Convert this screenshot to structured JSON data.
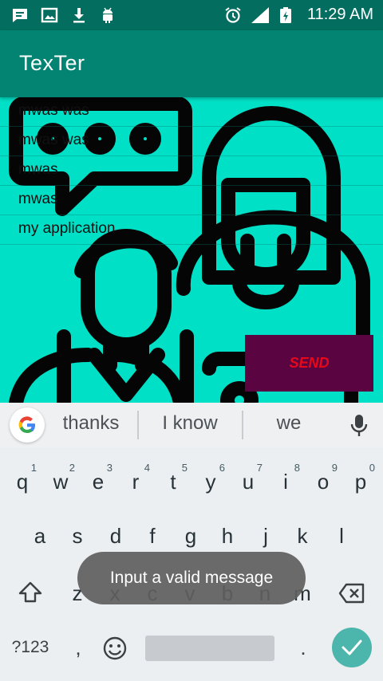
{
  "status_bar": {
    "time": "11:29 AM",
    "icons": [
      "chat-notification-icon",
      "image-notification-icon",
      "download-icon",
      "android-icon",
      "alarm-icon",
      "signal-icon",
      "battery-charging-icon"
    ]
  },
  "app_bar": {
    "title": "TexTer"
  },
  "messages": [
    "mwas was",
    "mwas was",
    "mwas",
    "mwas",
    "my application"
  ],
  "send_button": {
    "label": "SEND",
    "color": "#e8071a",
    "background": "#5a0541"
  },
  "suggestions": [
    "thanks",
    "I know",
    "we"
  ],
  "keyboard": {
    "row1": [
      {
        "key": "q",
        "hint": "1"
      },
      {
        "key": "w",
        "hint": "2"
      },
      {
        "key": "e",
        "hint": "3"
      },
      {
        "key": "r",
        "hint": "4"
      },
      {
        "key": "t",
        "hint": "5"
      },
      {
        "key": "y",
        "hint": "6"
      },
      {
        "key": "u",
        "hint": "7"
      },
      {
        "key": "i",
        "hint": "8"
      },
      {
        "key": "o",
        "hint": "9"
      },
      {
        "key": "p",
        "hint": "0"
      }
    ],
    "row2": [
      "a",
      "s",
      "d",
      "f",
      "g",
      "h",
      "j",
      "k",
      "l"
    ],
    "row3": [
      "z",
      "x",
      "c",
      "v",
      "b",
      "n",
      "m"
    ],
    "symbols_label": "?123",
    "comma": ",",
    "period": "."
  },
  "toast": {
    "text": "Input a valid message"
  },
  "colors": {
    "status_bar": "#036e60",
    "app_bar": "#038473",
    "content_bg": "#00e0c6",
    "enter_key": "#4db6ac"
  }
}
